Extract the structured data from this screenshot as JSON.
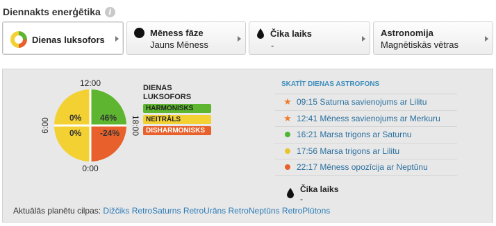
{
  "header": {
    "title": "Diennakts enerģētika",
    "info_icon": "info-icon"
  },
  "tabs": [
    {
      "title": "Dienas luksofors",
      "sub": "",
      "icon": "traffic-light-icon"
    },
    {
      "title": "Mēness fāze",
      "sub": "Jauns Mēness",
      "icon": "moon-phase-icon"
    },
    {
      "title": "Čika laiks",
      "sub": "-",
      "icon": "drop-icon"
    },
    {
      "title": "Astronomija",
      "sub": "Magnētiskās vētras",
      "icon": ""
    }
  ],
  "chart_data": {
    "type": "pie",
    "title": "",
    "quadrants": [
      {
        "hours": "12:00-18:00",
        "value": "46%",
        "color": "#5db530"
      },
      {
        "hours": "18:00-24:00",
        "value": "-24%",
        "color": "#e8602c"
      },
      {
        "hours": "0:00-6:00",
        "value": "0%",
        "color": "#f3d132"
      },
      {
        "hours": "6:00-12:00",
        "value": "0%",
        "color": "#f3d132"
      }
    ],
    "tick_labels": {
      "top": "12:00",
      "right": "18:00",
      "bottom": "0:00",
      "left": "6:00"
    },
    "legend_title": "DIENAS LUKSOFORS",
    "legend": [
      {
        "label": "HARMONISKS",
        "color": "#5db530"
      },
      {
        "label": "NEITRĀLS",
        "color": "#f3d132"
      },
      {
        "label": "DISHARMONISKS",
        "color": "#e8602c"
      }
    ]
  },
  "astro": {
    "head": "SKATĪT DIENAS ASTROFONS",
    "events": [
      {
        "text": "09:15 Saturna savienojums ar Lilitu",
        "marker": "star",
        "color": "#ef7c2f"
      },
      {
        "text": "12:41 Mēness savienojums ar Merkuru",
        "marker": "star",
        "color": "#ef7c2f"
      },
      {
        "text": "16:21 Marsa trigons ar Saturnu",
        "marker": "dot",
        "color": "#4fb534"
      },
      {
        "text": "17:56 Marsa trigons ar Lilitu",
        "marker": "dot",
        "color": "#e9c42c"
      },
      {
        "text": "22:17 Mēness opozīcija ar Neptūnu",
        "marker": "dot",
        "color": "#e8602c"
      }
    ]
  },
  "void": {
    "title": "Čika laiks",
    "value": "-"
  },
  "retro": {
    "label": "Aktuālās planētu cilpas:",
    "links": [
      "Dižčiks",
      "RetroSaturns",
      "RetroUrāns",
      "RetroNeptūns",
      "RetroPlūtons"
    ]
  }
}
